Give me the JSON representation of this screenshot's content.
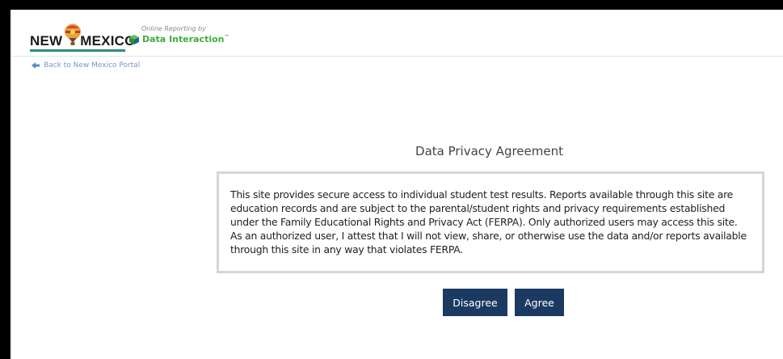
{
  "header": {
    "logo": {
      "state_word_1": "NEW",
      "state_word_2": "MEXICO",
      "vendor_tagline": "Online Reporting by",
      "vendor_name": "Data Interaction",
      "vendor_tm": "™"
    }
  },
  "nav": {
    "back_label": "Back to New Mexico Portal"
  },
  "agreement": {
    "title": "Data Privacy Agreement",
    "body": "This site provides secure access to individual student test results. Reports available through this site are education records and are subject to the parental/student rights and privacy requirements established under the Family Educational Rights and Privacy Act (FERPA). Only authorized users may access this site. As an authorized user, I attest that I will not view, share, or otherwise use the data and/or reports available through this site in any way that violates FERPA."
  },
  "actions": {
    "disagree_label": "Disagree",
    "agree_label": "Agree"
  },
  "colors": {
    "button_bg": "#1b3a61",
    "link": "#7a96c0",
    "brand_green": "#3fae3a",
    "box_border": "#d6d6d6"
  }
}
